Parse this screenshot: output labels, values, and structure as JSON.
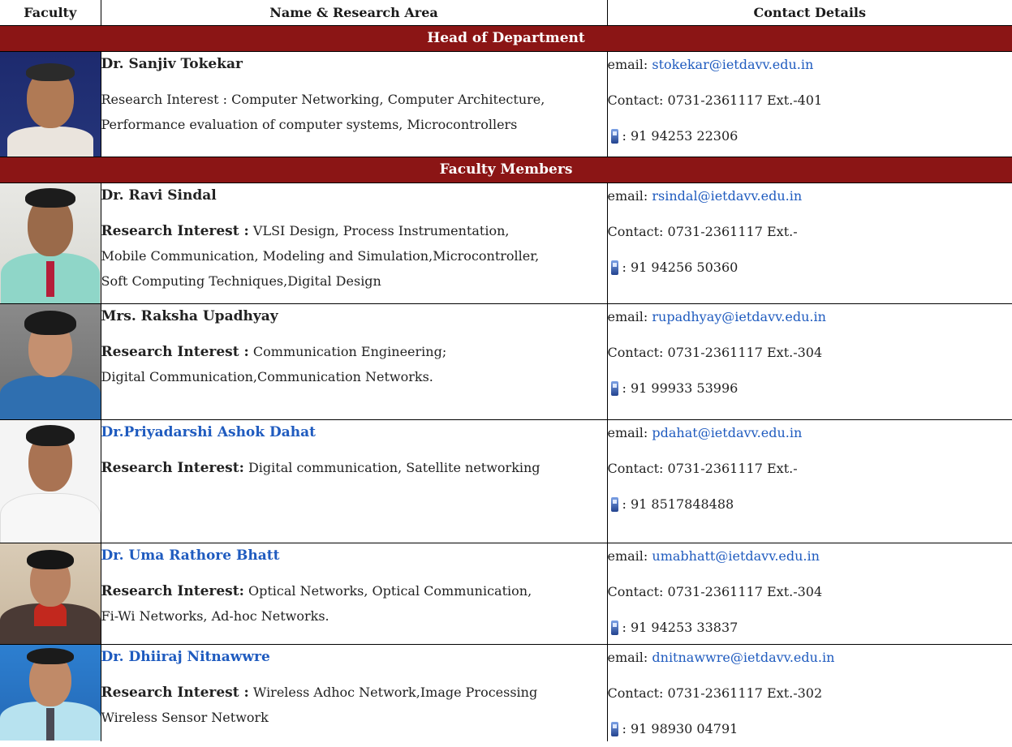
{
  "header": {
    "col_faculty": "Faculty",
    "col_name": "Name & Research Area",
    "col_contact": "Contact Details"
  },
  "sections": {
    "hod": "Head of Department",
    "members": "Faculty Members"
  },
  "people": [
    {
      "name": "Dr. Sanjiv Tokekar",
      "research_label": "",
      "research_lines": [
        "Research Interest : Computer Networking, Computer Architecture,",
        "Performance evaluation of computer systems, Microcontrollers"
      ],
      "email_label": "email: ",
      "email": "stokekar@ietdavv.edu.in",
      "contact": "Contact: 0731-2361117 Ext.-401",
      "mobile": ": 91 94253 22306"
    },
    {
      "name": "Dr. Ravi Sindal",
      "research_label": "Research Interest :",
      "research_lines": [
        " VLSI Design, Process Instrumentation,",
        "Mobile Communication, Modeling and Simulation,Microcontroller,",
        "Soft Computing Techniques,Digital Design"
      ],
      "email_label": "email: ",
      "email": "rsindal@ietdavv.edu.in",
      "contact": "Contact: 0731-2361117 Ext.-",
      "mobile": ": 91 94256 50360"
    },
    {
      "name": "Mrs. Raksha Upadhyay",
      "research_label": "Research Interest :",
      "research_lines": [
        " Communication Engineering;",
        "Digital Communication,Communication Networks."
      ],
      "email_label": "email: ",
      "email": "rupadhyay@ietdavv.edu.in",
      "contact": "Contact: 0731-2361117 Ext.-304",
      "mobile": ": 91 99933 53996"
    },
    {
      "name": "Dr.Priyadarshi Ashok Dahat",
      "research_label": "Research Interest:",
      "research_lines": [
        " Digital communication, Satellite networking"
      ],
      "email_label": "email: ",
      "email": "pdahat@ietdavv.edu.in",
      "contact": "Contact: 0731-2361117 Ext.-",
      "mobile": ": 91 8517848488"
    },
    {
      "name": "Dr. Uma Rathore Bhatt",
      "research_label": "Research Interest:",
      "research_lines": [
        " Optical Networks, Optical Communication,",
        "Fi-Wi Networks, Ad-hoc Networks."
      ],
      "email_label": "email: ",
      "email": "umabhatt@ietdavv.edu.in",
      "contact": "Contact: 0731-2361117 Ext.-304",
      "mobile": ": 91 94253 33837"
    },
    {
      "name": "Dr. Dhiiraj Nitnawwre",
      "research_label": "Research Interest :",
      "research_lines": [
        " Wireless Adhoc Network,Image Processing",
        "Wireless Sensor Network"
      ],
      "email_label": "email: ",
      "email": "dnitnawwre@ietdavv.edu.in",
      "contact": "Contact: 0731-2361117 Ext.-302",
      "mobile": ": 91 98930 04791"
    }
  ],
  "colors": {
    "section_bg": "#8b1515",
    "link": "#1f5bbf"
  }
}
